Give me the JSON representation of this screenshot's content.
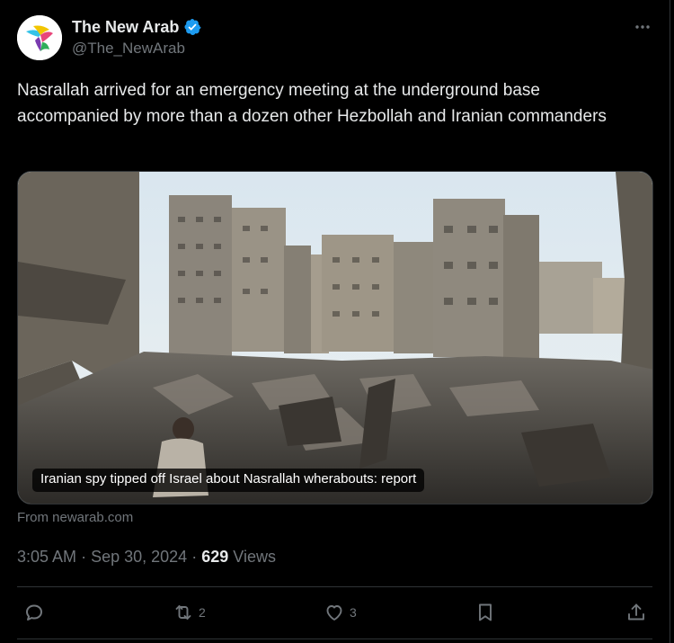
{
  "author": {
    "name": "The New Arab",
    "handle": "@The_NewArab",
    "verified": true,
    "verified_color": "#1d9bf0"
  },
  "post": {
    "text": "Nasrallah arrived for an emergency meeting at the underground base accompanied by more than a dozen other Hezbollah and Iranian commanders"
  },
  "card": {
    "headline": "Iranian spy tipped off Israel about Nasrallah wherabouts: report",
    "source": "From newarab.com"
  },
  "meta": {
    "time": "3:05 AM",
    "separator": "·",
    "date": "Sep 30, 2024",
    "views_count": "629",
    "views_label": "Views"
  },
  "actions": {
    "reply_count": "",
    "repost_count": "2",
    "like_count": "3"
  },
  "icons": {
    "more": "more-horizontal-icon",
    "reply": "reply-icon",
    "repost": "repost-icon",
    "like": "heart-icon",
    "bookmark": "bookmark-icon",
    "share": "share-icon"
  },
  "colors": {
    "background": "#000000",
    "text_primary": "#e7e9ea",
    "text_secondary": "#71767b",
    "divider": "#2f3336"
  }
}
